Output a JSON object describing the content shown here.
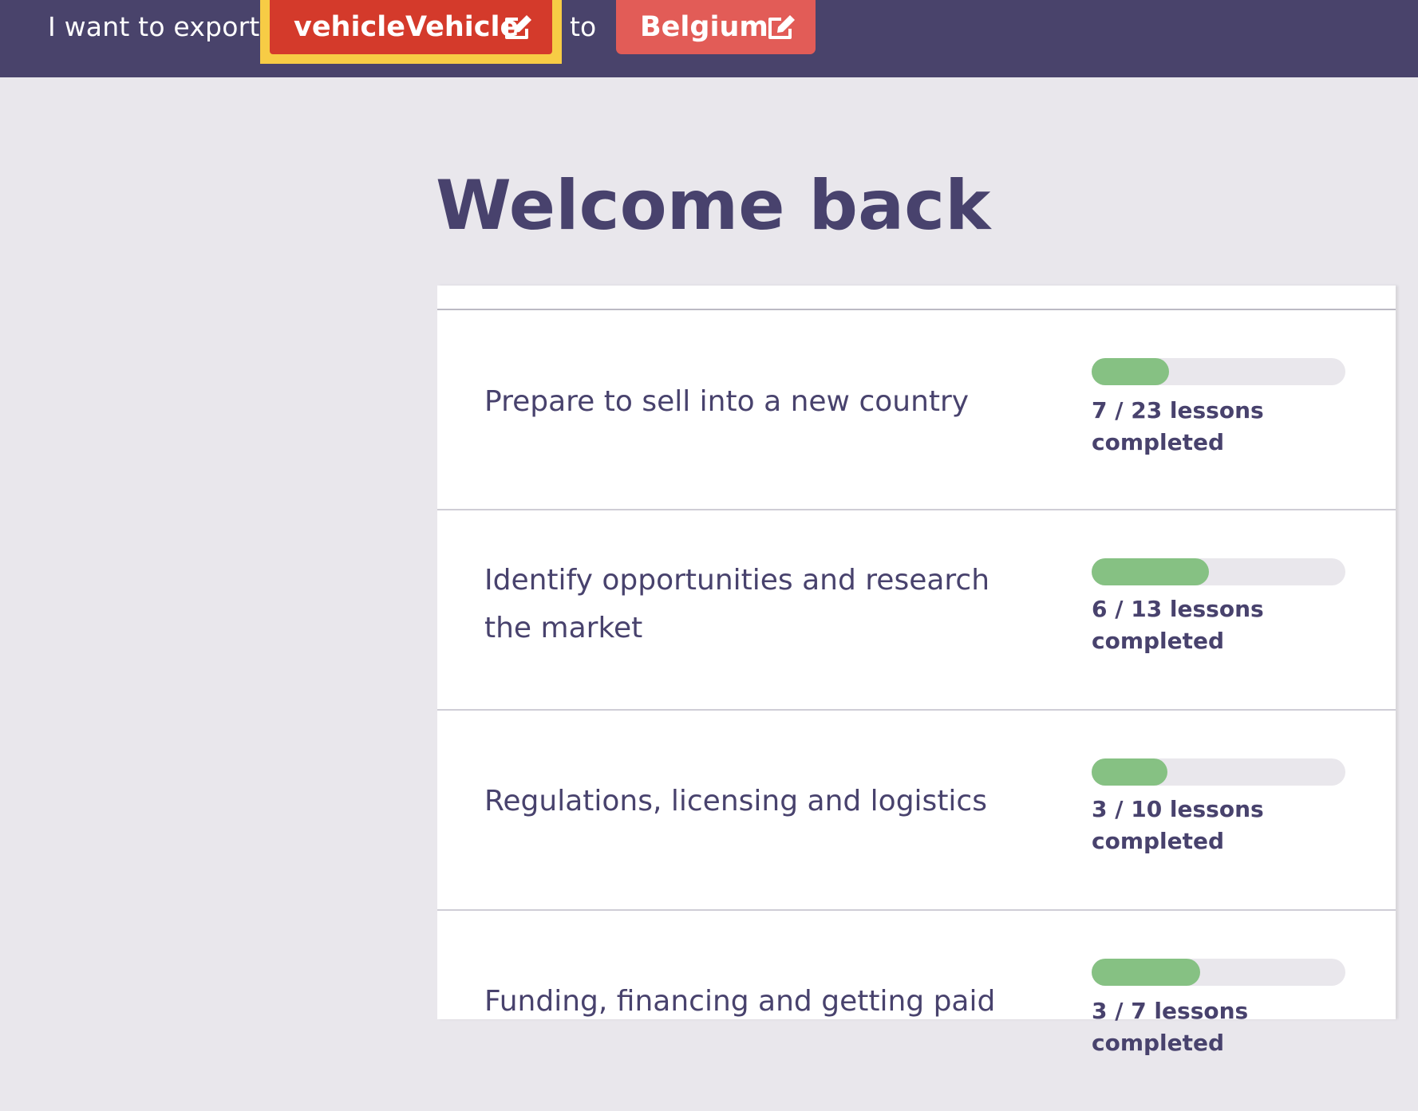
{
  "header": {
    "lead_text": "I want to export",
    "product_label": "vehicleVehicle",
    "connector_text": "to",
    "country_label": "Belgium",
    "edit_icon": "edit-icon"
  },
  "colors": {
    "topbar": "#49436b",
    "product_chip": "#d43a2b",
    "country_chip": "#e25c57",
    "focus_ring": "#f7cc45",
    "progress_fill": "#86c183",
    "progress_track": "#e9e7ec",
    "text": "#48426d"
  },
  "main": {
    "heading": "Welcome back",
    "topics": [
      {
        "title": "Prepare to sell into a new country",
        "progress_text": "7 / 23 lessons completed",
        "completed": 7,
        "total": 23
      },
      {
        "title": "Identify opportunities and research the market",
        "progress_text": "6 / 13 lessons completed",
        "completed": 6,
        "total": 13
      },
      {
        "title": "Regulations, licensing and logistics",
        "progress_text": "3 / 10 lessons completed",
        "completed": 3,
        "total": 10
      },
      {
        "title": "Funding, financing and getting paid",
        "progress_text": "3 / 7 lessons completed",
        "completed": 3,
        "total": 7
      }
    ]
  }
}
